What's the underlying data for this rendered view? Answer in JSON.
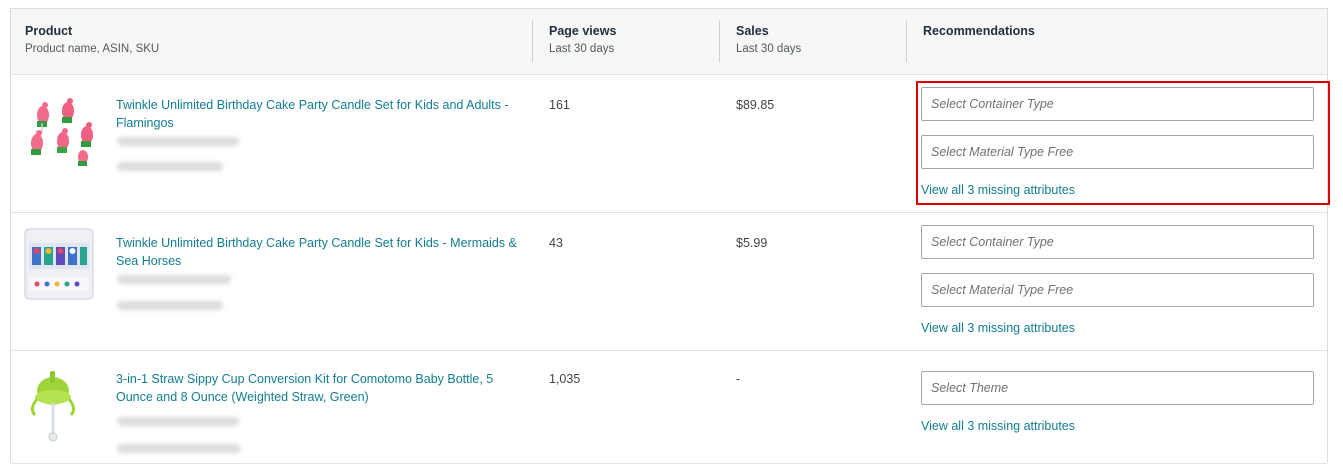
{
  "header": {
    "product": {
      "title": "Product",
      "subtitle": "Product name, ASIN, SKU"
    },
    "page_views": {
      "title": "Page views",
      "subtitle": "Last 30 days"
    },
    "sales": {
      "title": "Sales",
      "subtitle": "Last 30 days"
    },
    "recommendations": {
      "title": "Recommendations"
    }
  },
  "rows": [
    {
      "title": "Twinkle Unlimited Birthday Cake Party Candle Set for Kids and Adults - Flamingos",
      "page_views": "161",
      "sales": "$89.85",
      "selects": [
        "Select Container Type",
        "Select Material Type Free"
      ],
      "view_all": "View all 3 missing attributes"
    },
    {
      "title": "Twinkle Unlimited Birthday Cake Party Candle Set for Kids - Mermaids & Sea Horses",
      "page_views": "43",
      "sales": "$5.99",
      "selects": [
        "Select Container Type",
        "Select Material Type Free"
      ],
      "view_all": "View all 3 missing attributes"
    },
    {
      "title": "3-in-1 Straw Sippy Cup Conversion Kit for Comotomo Baby Bottle, 5 Ounce and 8 Ounce (Weighted Straw, Green)",
      "page_views": "1,035",
      "sales": "-",
      "selects": [
        "Select Theme"
      ],
      "view_all": "View all 3 missing attributes"
    }
  ],
  "colors": {
    "link": "#137d92",
    "highlight": "#e00000",
    "header_bg": "#f6f7f7"
  }
}
